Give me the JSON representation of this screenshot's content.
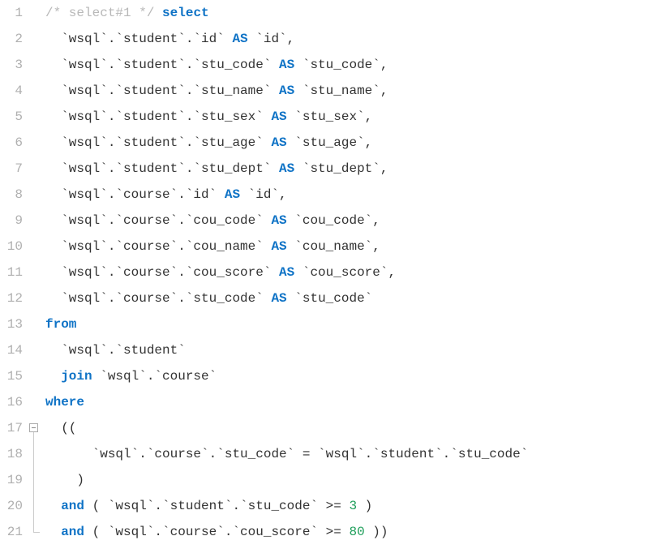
{
  "lines": [
    {
      "num": "1",
      "fold": "",
      "tokens": [
        {
          "t": "comment",
          "v": "/* select#1 */"
        },
        {
          "t": "txt",
          "v": " "
        },
        {
          "t": "kw",
          "v": "select"
        }
      ]
    },
    {
      "num": "2",
      "fold": "",
      "tokens": [
        {
          "t": "txt",
          "v": "  `wsql`.`student`.`id` "
        },
        {
          "t": "kw",
          "v": "AS"
        },
        {
          "t": "txt",
          "v": " `id`,"
        }
      ]
    },
    {
      "num": "3",
      "fold": "",
      "tokens": [
        {
          "t": "txt",
          "v": "  `wsql`.`student`.`stu_code` "
        },
        {
          "t": "kw",
          "v": "AS"
        },
        {
          "t": "txt",
          "v": " `stu_code`,"
        }
      ]
    },
    {
      "num": "4",
      "fold": "",
      "tokens": [
        {
          "t": "txt",
          "v": "  `wsql`.`student`.`stu_name` "
        },
        {
          "t": "kw",
          "v": "AS"
        },
        {
          "t": "txt",
          "v": " `stu_name`,"
        }
      ]
    },
    {
      "num": "5",
      "fold": "",
      "tokens": [
        {
          "t": "txt",
          "v": "  `wsql`.`student`.`stu_sex` "
        },
        {
          "t": "kw",
          "v": "AS"
        },
        {
          "t": "txt",
          "v": " `stu_sex`,"
        }
      ]
    },
    {
      "num": "6",
      "fold": "",
      "tokens": [
        {
          "t": "txt",
          "v": "  `wsql`.`student`.`stu_age` "
        },
        {
          "t": "kw",
          "v": "AS"
        },
        {
          "t": "txt",
          "v": " `stu_age`,"
        }
      ]
    },
    {
      "num": "7",
      "fold": "",
      "tokens": [
        {
          "t": "txt",
          "v": "  `wsql`.`student`.`stu_dept` "
        },
        {
          "t": "kw",
          "v": "AS"
        },
        {
          "t": "txt",
          "v": " `stu_dept`,"
        }
      ]
    },
    {
      "num": "8",
      "fold": "",
      "tokens": [
        {
          "t": "txt",
          "v": "  `wsql`.`course`.`id` "
        },
        {
          "t": "kw",
          "v": "AS"
        },
        {
          "t": "txt",
          "v": " `id`,"
        }
      ]
    },
    {
      "num": "9",
      "fold": "",
      "tokens": [
        {
          "t": "txt",
          "v": "  `wsql`.`course`.`cou_code` "
        },
        {
          "t": "kw",
          "v": "AS"
        },
        {
          "t": "txt",
          "v": " `cou_code`,"
        }
      ]
    },
    {
      "num": "10",
      "fold": "",
      "tokens": [
        {
          "t": "txt",
          "v": "  `wsql`.`course`.`cou_name` "
        },
        {
          "t": "kw",
          "v": "AS"
        },
        {
          "t": "txt",
          "v": " `cou_name`,"
        }
      ]
    },
    {
      "num": "11",
      "fold": "",
      "tokens": [
        {
          "t": "txt",
          "v": "  `wsql`.`course`.`cou_score` "
        },
        {
          "t": "kw",
          "v": "AS"
        },
        {
          "t": "txt",
          "v": " `cou_score`,"
        }
      ]
    },
    {
      "num": "12",
      "fold": "",
      "tokens": [
        {
          "t": "txt",
          "v": "  `wsql`.`course`.`stu_code` "
        },
        {
          "t": "kw",
          "v": "AS"
        },
        {
          "t": "txt",
          "v": " `stu_code`"
        }
      ]
    },
    {
      "num": "13",
      "fold": "",
      "tokens": [
        {
          "t": "kw",
          "v": "from"
        }
      ]
    },
    {
      "num": "14",
      "fold": "",
      "tokens": [
        {
          "t": "txt",
          "v": "  `wsql`.`student`"
        }
      ]
    },
    {
      "num": "15",
      "fold": "",
      "tokens": [
        {
          "t": "txt",
          "v": "  "
        },
        {
          "t": "kw",
          "v": "join"
        },
        {
          "t": "txt",
          "v": " `wsql`.`course`"
        }
      ]
    },
    {
      "num": "16",
      "fold": "",
      "tokens": [
        {
          "t": "kw",
          "v": "where"
        }
      ]
    },
    {
      "num": "17",
      "fold": "start",
      "tokens": [
        {
          "t": "txt",
          "v": "  (("
        }
      ]
    },
    {
      "num": "18",
      "fold": "mid",
      "tokens": [
        {
          "t": "txt",
          "v": "      `wsql`.`course`.`stu_code` = `wsql`.`student`.`stu_code`"
        }
      ]
    },
    {
      "num": "19",
      "fold": "mid",
      "tokens": [
        {
          "t": "txt",
          "v": "    )"
        }
      ]
    },
    {
      "num": "20",
      "fold": "mid",
      "tokens": [
        {
          "t": "txt",
          "v": "  "
        },
        {
          "t": "kw",
          "v": "and"
        },
        {
          "t": "txt",
          "v": " ( `wsql`.`student`.`stu_code` >= "
        },
        {
          "t": "num",
          "v": "3"
        },
        {
          "t": "txt",
          "v": " )"
        }
      ]
    },
    {
      "num": "21",
      "fold": "end",
      "tokens": [
        {
          "t": "txt",
          "v": "  "
        },
        {
          "t": "kw",
          "v": "and"
        },
        {
          "t": "txt",
          "v": " ( `wsql`.`course`.`cou_score` >= "
        },
        {
          "t": "num",
          "v": "80"
        },
        {
          "t": "txt",
          "v": " ))"
        }
      ]
    }
  ]
}
